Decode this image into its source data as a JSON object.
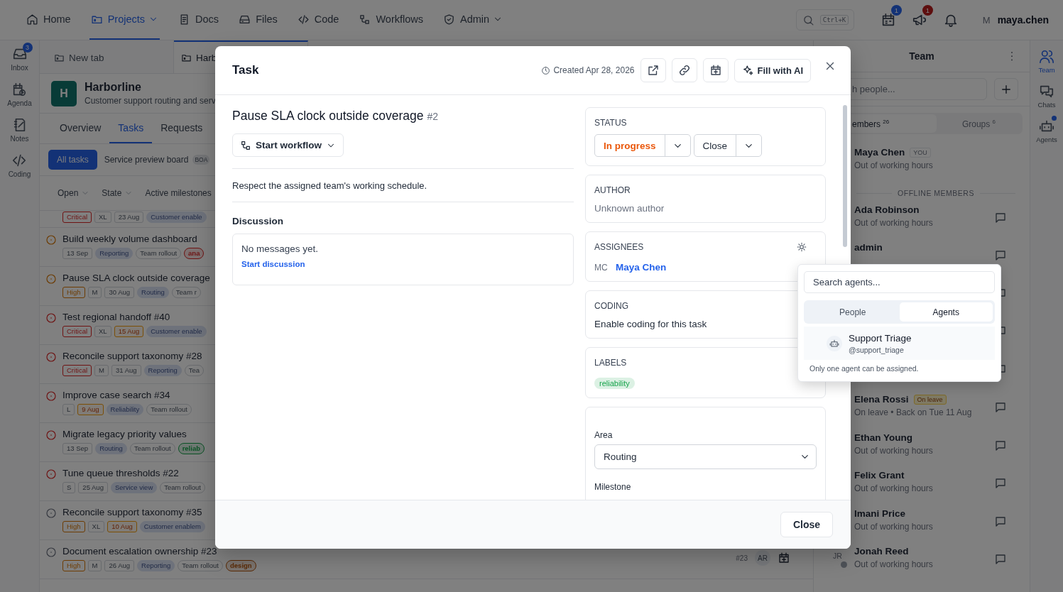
{
  "topbar": {
    "nav": [
      {
        "label": "Home",
        "selected": false,
        "dropdown": false
      },
      {
        "label": "Projects",
        "selected": true,
        "dropdown": true
      },
      {
        "label": "Docs",
        "selected": false,
        "dropdown": false
      },
      {
        "label": "Files",
        "selected": false,
        "dropdown": false
      },
      {
        "label": "Code",
        "selected": false,
        "dropdown": false
      },
      {
        "label": "Workflows",
        "selected": false,
        "dropdown": false
      },
      {
        "label": "Admin",
        "selected": false,
        "dropdown": true
      }
    ],
    "search": {
      "shortcut": "Ctrl+K"
    },
    "notifications": [
      {
        "badge": "1",
        "color": "#133276"
      },
      {
        "badge": "1",
        "color": "#5d0e0e"
      }
    ],
    "user": {
      "initial": "M",
      "name": "maya.chen"
    }
  },
  "left_rail": [
    {
      "label": "Inbox",
      "badge": "3"
    },
    {
      "label": "Agenda"
    },
    {
      "label": "Notes"
    },
    {
      "label": "Coding"
    }
  ],
  "main": {
    "tabs": [
      {
        "label": "New tab",
        "selected": false
      },
      {
        "label": "Harb",
        "selected": true
      }
    ],
    "project": {
      "initial": "H",
      "name": "Harborline",
      "description": "Customer support routing and serv"
    },
    "sections": [
      {
        "label": "Overview",
        "selected": false
      },
      {
        "label": "Tasks",
        "selected": true
      },
      {
        "label": "Requests",
        "selected": false
      }
    ],
    "views": [
      {
        "label": "All tasks",
        "selected": true
      },
      {
        "label": "Service preview board",
        "selected": false,
        "badge": "BOA"
      }
    ],
    "filters": [
      {
        "label": "Open",
        "dropdown": true
      },
      {
        "label": "State",
        "dropdown": true
      },
      {
        "label": "Active milestones",
        "dropdown": false
      }
    ],
    "tasks": [
      {
        "tags": [
          {
            "kind": "priority",
            "text": "Critical",
            "color": "#6e1313"
          },
          {
            "kind": "plain",
            "text": "XL"
          },
          {
            "kind": "date",
            "text": "23 Aug",
            "overdue": false
          },
          {
            "kind": "area",
            "text": "Customer enable"
          }
        ]
      },
      {
        "title": "Build weekly volume dashboard",
        "color": "#6d3c03",
        "tags": [
          {
            "kind": "date",
            "text": "13 Sep",
            "overdue": false
          },
          {
            "kind": "area",
            "text": "Reporting"
          },
          {
            "kind": "milestone",
            "text": "Team rollout"
          },
          {
            "kind": "label",
            "text": "ana",
            "color": "#6e1313"
          }
        ]
      },
      {
        "title": "Pause SLA clock outside coverage",
        "color": "#6d3c03",
        "tags": [
          {
            "kind": "priority",
            "text": "High",
            "color": "#6d3c03"
          },
          {
            "kind": "plain",
            "text": "M"
          },
          {
            "kind": "date",
            "text": "30 Aug",
            "overdue": false
          },
          {
            "kind": "area",
            "text": "Routing"
          },
          {
            "kind": "milestone",
            "text": "Team r"
          }
        ]
      },
      {
        "title": "Test regional handoff #40",
        "color": "#6e1313",
        "tags": [
          {
            "kind": "priority",
            "text": "Critical",
            "color": "#6e1313"
          },
          {
            "kind": "plain",
            "text": "XL"
          },
          {
            "kind": "date",
            "text": "15 Aug",
            "overdue": true
          },
          {
            "kind": "area",
            "text": "Customer enable"
          }
        ]
      },
      {
        "title": "Reconcile support taxonomy #28",
        "color": "#6e1313",
        "tags": [
          {
            "kind": "priority",
            "text": "Critical",
            "color": "#6e1313"
          },
          {
            "kind": "plain",
            "text": "M"
          },
          {
            "kind": "date",
            "text": "31 Aug",
            "overdue": false
          },
          {
            "kind": "area",
            "text": "Reporting"
          },
          {
            "kind": "milestone",
            "text": "Tea"
          }
        ]
      },
      {
        "title": "Improve case search #34",
        "color": "#6e1313",
        "tags": [
          {
            "kind": "plain",
            "text": "L"
          },
          {
            "kind": "date",
            "text": "9 Aug",
            "overdue": true
          },
          {
            "kind": "area",
            "text": "Reliability"
          },
          {
            "kind": "milestone",
            "text": "Team rollout"
          }
        ]
      },
      {
        "title": "Migrate legacy priority values",
        "color": "#6e1313",
        "tags": [
          {
            "kind": "date",
            "text": "13 Sep",
            "overdue": false
          },
          {
            "kind": "area",
            "text": "Routing"
          },
          {
            "kind": "milestone",
            "text": "Team rollout"
          },
          {
            "kind": "label",
            "text": "reliab",
            "color": "#0b5225"
          }
        ]
      },
      {
        "title": "Tune queue thresholds #22",
        "color": "#6e1313",
        "tags": [
          {
            "kind": "plain",
            "text": "S"
          },
          {
            "kind": "date",
            "text": "25 Aug",
            "overdue": false
          },
          {
            "kind": "area",
            "text": "Service view"
          },
          {
            "kind": "milestone",
            "text": "Team rollout"
          }
        ]
      },
      {
        "title": "Reconcile support taxonomy #35",
        "color": "#363940",
        "tags": [
          {
            "kind": "priority",
            "text": "High",
            "color": "#6d3c03"
          },
          {
            "kind": "plain",
            "text": "XL"
          },
          {
            "kind": "date",
            "text": "10 Aug",
            "overdue": true
          },
          {
            "kind": "area",
            "text": "Customer enablem"
          }
        ]
      },
      {
        "title": "Document escalation ownership #23",
        "color": "#363940",
        "tags": [
          {
            "kind": "priority",
            "text": "High",
            "color": "#6d3c03"
          },
          {
            "kind": "plain",
            "text": "M"
          },
          {
            "kind": "date",
            "text": "26 Aug",
            "overdue": false
          },
          {
            "kind": "area",
            "text": "Reporting"
          },
          {
            "kind": "milestone",
            "text": "Team rollout"
          },
          {
            "kind": "label",
            "text": "design",
            "color": "#5a2a05"
          }
        ],
        "number": "#23",
        "assignee": "AR"
      }
    ]
  },
  "team_panel": {
    "title": "Team",
    "search": {
      "placeholder": "h people..."
    },
    "tabs": [
      {
        "label": "embers",
        "count": "26",
        "selected": true
      },
      {
        "label": "Groups",
        "count": "6",
        "selected": false
      }
    ],
    "members": [
      {
        "kind": "member",
        "name": "Maya Chen",
        "badge": {
          "kind": "self",
          "text": "YOU"
        },
        "status": "Out of working hours",
        "chat_button": false
      },
      {
        "kind": "divider",
        "label": "OFFLINE MEMBERS"
      },
      {
        "kind": "member",
        "name": "Ada Robinson",
        "status": "Out of working hours",
        "chat_button": true
      },
      {
        "kind": "member",
        "name": "admin",
        "chat_button": true
      },
      {
        "kind": "member",
        "chat_button": true
      },
      {
        "kind": "member",
        "chat_button": true
      },
      {
        "kind": "member",
        "chat_button": true
      },
      {
        "kind": "member",
        "name": "Elena Rossi",
        "badge": {
          "kind": "leave",
          "text": "On leave"
        },
        "status": "On leave • Back on Tue 11 Aug",
        "chat_button": true
      },
      {
        "kind": "member",
        "name": "Ethan Young",
        "status": "Out of working hours",
        "chat_button": true
      },
      {
        "kind": "member",
        "name": "Felix Grant",
        "status": "Out of working hours",
        "chat_button": true
      },
      {
        "kind": "member",
        "name": "Imani Price",
        "status": "Out of working hours",
        "chat_button": true
      },
      {
        "kind": "member",
        "name": "Jonah Reed",
        "avatar": "JR",
        "status": "Out of working hours",
        "chat_button": true
      }
    ]
  },
  "right_rail": [
    {
      "label": "Team",
      "selected": true,
      "dot": false
    },
    {
      "label": "Chats",
      "selected": false,
      "dot": false
    },
    {
      "label": "Agents",
      "selected": false,
      "dot": true
    }
  ],
  "modal": {
    "title": "Task",
    "created": "Created Apr 28, 2026",
    "ai_button": "Fill with AI",
    "task": {
      "title": "Pause SLA clock outside coverage",
      "number": "#2",
      "workflow_button": "Start workflow",
      "description": "Respect the assigned team's working schedule.",
      "discussion": {
        "heading": "Discussion",
        "empty": "No messages yet.",
        "link": "Start discussion"
      }
    },
    "status": {
      "heading": "STATUS",
      "state": "In progress",
      "action": "Close"
    },
    "author": {
      "heading": "AUTHOR",
      "value": "Unknown author"
    },
    "assignees": {
      "heading": "ASSIGNEES",
      "people": [
        {
          "initials": "MC",
          "name": "Maya Chen"
        }
      ]
    },
    "coding": {
      "heading": "CODING",
      "label": "Enable coding for this task"
    },
    "labels": {
      "heading": "LABELS",
      "items": [
        {
          "text": "reliability",
          "color": "#16a34a"
        }
      ]
    },
    "fields": [
      {
        "label": "Area",
        "value": "Routing"
      },
      {
        "label": "Milestone"
      }
    ],
    "footer_button": "Close"
  },
  "agent_picker": {
    "search": {
      "placeholder": "Search agents..."
    },
    "tabs": [
      {
        "label": "People",
        "selected": false
      },
      {
        "label": "Agents",
        "selected": true
      }
    ],
    "agents": [
      {
        "name": "Support Triage",
        "handle": "@support_triage"
      }
    ],
    "note": "Only one agent can be assigned."
  }
}
